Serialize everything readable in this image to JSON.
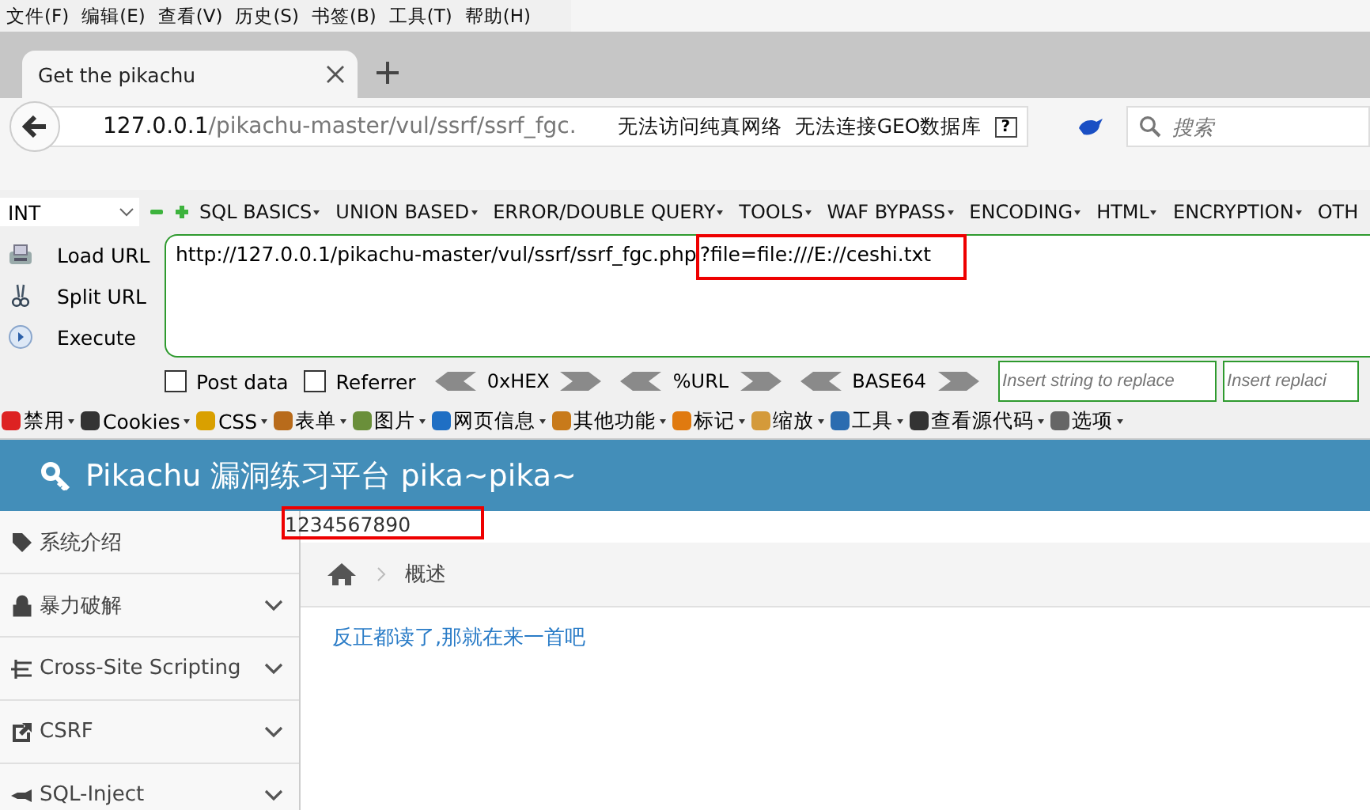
{
  "menu_bar": [
    "文件(F)",
    "编辑(E)",
    "查看(V)",
    "历史(S)",
    "书签(B)",
    "工具(T)",
    "帮助(H)"
  ],
  "tab": {
    "title": "Get the pikachu",
    "selected": true
  },
  "url_bar": {
    "host": "127.0.0.1",
    "path": "/pikachu-master/vul/ssrf/ssrf_fgc.",
    "notices": [
      "无法访问纯真网络",
      "无法连接GEO数据库"
    ],
    "help": "?"
  },
  "search": {
    "placeholder": "搜索"
  },
  "hackbar": {
    "type_select": "INT",
    "menus": [
      "SQL BASICS",
      "UNION BASED",
      "ERROR/DOUBLE QUERY",
      "TOOLS",
      "WAF BYPASS",
      "ENCODING",
      "HTML",
      "ENCRYPTION",
      "OTH"
    ],
    "actions": [
      "Load URL",
      "Split URL",
      "Execute"
    ],
    "url": "http://127.0.0.1/pikachu-master/vul/ssrf/ssrf_fgc.php",
    "url_highlighted": "?file=file:///E://ceshi.txt",
    "checkboxes": [
      {
        "label": "Post data",
        "checked": false
      },
      {
        "label": "Referrer",
        "checked": false
      }
    ],
    "encoders": [
      "0xHEX",
      "%URL",
      "BASE64"
    ],
    "replace_fields": [
      {
        "placeholder": "Insert string to replace"
      },
      {
        "placeholder": "Insert replaci"
      }
    ]
  },
  "dev_toolbar": [
    "禁用",
    "Cookies",
    "CSS",
    "表单",
    "图片",
    "网页信息",
    "其他功能",
    "标记",
    "缩放",
    "工具",
    "查看源代码",
    "选项"
  ],
  "page": {
    "title": "Pikachu 漏洞练习平台 pika~pika~",
    "output": "1234567890",
    "sidebar": [
      {
        "label": "系统介绍",
        "has_submenu": false
      },
      {
        "label": "暴力破解",
        "has_submenu": true
      },
      {
        "label": "Cross-Site Scripting",
        "has_submenu": true
      },
      {
        "label": "CSRF",
        "has_submenu": true
      },
      {
        "label": "SQL-Inject",
        "has_submenu": true
      }
    ],
    "breadcrumb": "概述",
    "link": "反正都读了,那就在来一首吧"
  }
}
